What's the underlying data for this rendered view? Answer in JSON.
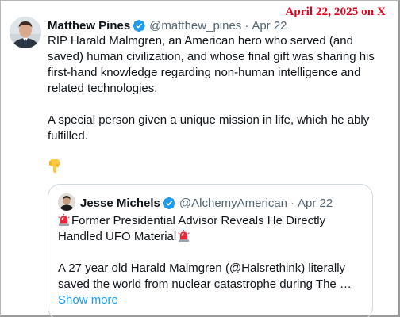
{
  "stamp": "April 22, 2025 on X",
  "colors": {
    "accent": "#1d9bf0",
    "stamp": "#e0001b",
    "muted": "#536471"
  },
  "tweet": {
    "author_name": "Matthew Pines",
    "handle": "@matthew_pines",
    "separator": "·",
    "date": "Apr 22",
    "paragraph1": "RIP Harald Malmgren, an American hero who served (and saved) human civilization, and whose final gift was sharing his first-hand knowledge regarding non-human intelligence and related technologies.",
    "paragraph2": "A special person given a unique mission in life, which he ably fulfilled.",
    "emoji": "backhand-index-pointing-down-icon"
  },
  "quote": {
    "author_name": "Jesse Michels",
    "handle": "@AlchemyAmerican",
    "separator": "·",
    "date": "Apr 22",
    "headline": "Former Presidential Advisor Reveals He Directly Handled UFO Material",
    "body": "A 27 year old Harald Malmgren (@Halsrethink) literally saved the world from nuclear catastrophe during The …",
    "show_more": "Show more"
  }
}
